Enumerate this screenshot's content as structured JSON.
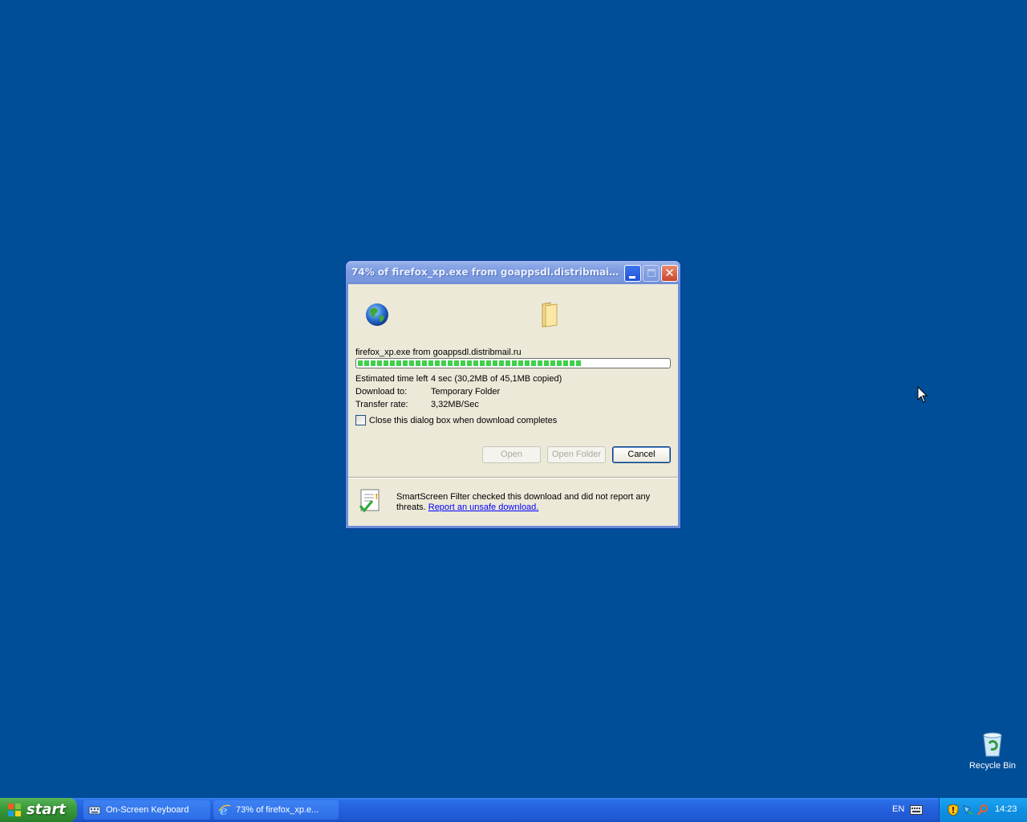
{
  "dialog": {
    "title": "74% of firefox_xp.exe from goappsdl.distribmail.ru...",
    "filename": "firefox_xp.exe from goappsdl.distribmail.ru",
    "progress_fraction": 0.72,
    "estimated_label": "Estimated time left",
    "estimated_value": "4 sec (30,2MB of 45,1MB copied)",
    "download_to_label": "Download to:",
    "download_to_value": "Temporary Folder",
    "transfer_label": "Transfer rate:",
    "transfer_value": "3,32MB/Sec",
    "close_checkbox_label": "Close this dialog box when download completes",
    "close_checkbox_checked": false,
    "buttons": {
      "open": "Open",
      "open_folder": "Open Folder",
      "cancel": "Cancel"
    },
    "smartscreen_text": "SmartScreen Filter checked this download and did not report any threats.",
    "smartscreen_link": "Report an unsafe download."
  },
  "desktop": {
    "recycle_bin_label": "Recycle Bin",
    "background_color": "#004e98"
  },
  "taskbar": {
    "start_label": "start",
    "tasks": [
      {
        "label": "On-Screen Keyboard",
        "icon": "keyboard-icon"
      },
      {
        "label": "73% of firefox_xp.e...",
        "icon": "ie-icon"
      }
    ],
    "language": "EN",
    "clock": "14:23"
  }
}
